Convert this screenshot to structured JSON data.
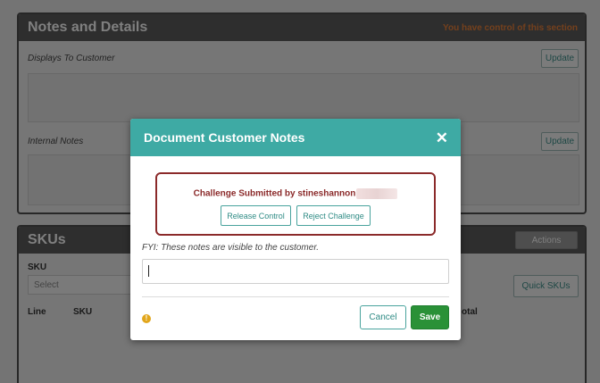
{
  "notes_panel": {
    "title": "Notes and Details",
    "control_text": "You have control of this section",
    "displays_label": "Displays To Customer",
    "internal_label": "Internal Notes",
    "update_label": "Update"
  },
  "sku_panel": {
    "title": "SKUs",
    "actions_label": "Actions",
    "sku_label": "SKU",
    "select_placeholder": "Select",
    "quick_skus_label": "Quick SKUs",
    "columns": [
      "Line",
      "SKU",
      "otal"
    ]
  },
  "modal": {
    "title": "Document Customer Notes",
    "close_symbol": "✕",
    "challenge_text": "Challenge Submitted by stineshannon",
    "release_label": "Release Control",
    "reject_label": "Reject Challenge",
    "fyi_text": "FYI: These notes are visible to the customer.",
    "notes_value": "",
    "info_symbol": "!",
    "cancel_label": "Cancel",
    "save_label": "Save"
  },
  "colors": {
    "teal": "#3eaaa4",
    "challenge_red": "#8b2a2a",
    "save_green": "#2a9137",
    "header_dark": "#5c5c5c",
    "control_orange": "#e8813a"
  }
}
